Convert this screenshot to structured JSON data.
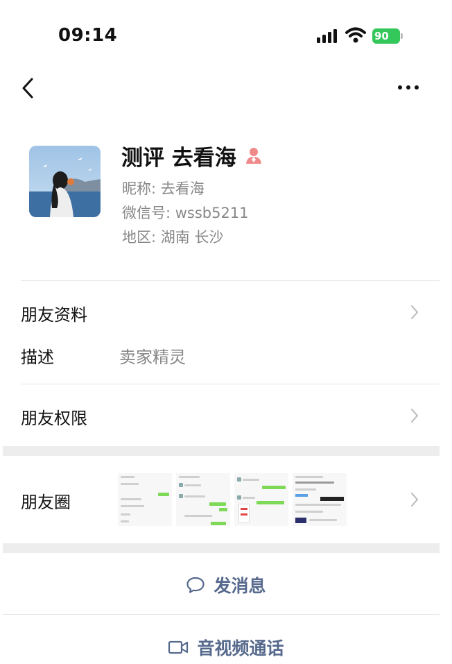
{
  "status_bar": {
    "time": "09:14",
    "battery": "90"
  },
  "profile": {
    "name": "测评 去看海",
    "nickname": "昵称: 去看海",
    "wechat_id": "微信号: wssb5211",
    "region": "地区: 湖南 长沙",
    "gender_icon": "female-icon"
  },
  "rows": {
    "friend_info": "朋友资料",
    "description_label": "描述",
    "description_value": "卖家精灵",
    "permissions": "朋友权限",
    "moments": "朋友圈"
  },
  "actions": {
    "send_message": "发消息",
    "video_call": "音视频通话"
  },
  "colors": {
    "accent": "#56698c",
    "battery": "#34c759",
    "female": "#f08a8a"
  }
}
